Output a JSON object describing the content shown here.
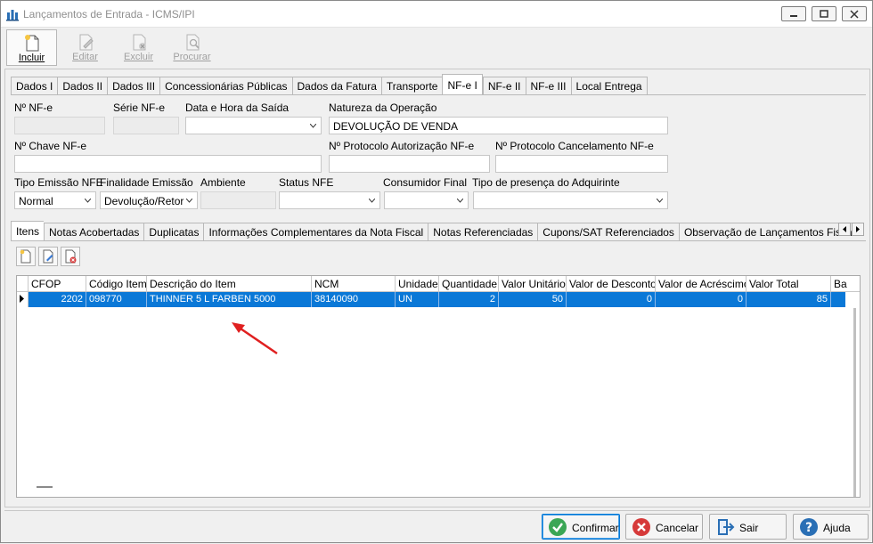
{
  "window": {
    "title": "Lançamentos de Entrada - ICMS/IPI"
  },
  "toolbar": {
    "incluir": "Incluir",
    "editar": "Editar",
    "excluir": "Excluir",
    "procurar": "Procurar"
  },
  "tabs": [
    "Dados I",
    "Dados II",
    "Dados III",
    "Concessionárias Públicas",
    "Dados da Fatura",
    "Transporte",
    "NF-e I",
    "NF-e II",
    "NF-e III",
    "Local Entrega"
  ],
  "form": {
    "nf_e_label": "Nº NF-e",
    "nf_e_value": "",
    "serie_label": "Série NF-e",
    "serie_value": "",
    "data_saida_label": "Data e Hora da Saída",
    "data_saida_value": "",
    "natureza_label": "Natureza da Operação",
    "natureza_value": "DEVOLUÇÃO DE VENDA",
    "chave_label": "Nº Chave NF-e",
    "chave_value": "",
    "protocolo_aut_label": "Nº Protocolo Autorização NF-e",
    "protocolo_aut_value": "",
    "protocolo_canc_label": "Nº Protocolo Cancelamento NF-e",
    "protocolo_canc_value": "",
    "tipo_emissao_label": "Tipo Emissão NFE",
    "tipo_emissao_value": "Normal",
    "finalidade_label": "Finalidade Emissão",
    "finalidade_value": "Devolução/Retor",
    "ambiente_label": "Ambiente",
    "ambiente_value": "",
    "status_label": "Status NFE",
    "status_value": "",
    "consumidor_label": "Consumidor Final",
    "consumidor_value": "",
    "presenca_label": "Tipo de presença do Adquirinte",
    "presenca_value": ""
  },
  "item_tabs": [
    "Itens",
    "Notas Acobertadas",
    "Duplicatas",
    "Informações Complementares da Nota Fiscal",
    "Notas Referenciadas",
    "Cupons/SAT Referenciados",
    "Observação de Lançamentos Fiscais (C"
  ],
  "grid": {
    "columns": [
      "CFOP",
      "Código Item",
      "Descrição do Item",
      "NCM",
      "Unidade",
      "Quantidade",
      "Valor Unitário",
      "Valor de Desconto",
      "Valor de Acréscimo",
      "Valor Total",
      "Ba"
    ],
    "rows": [
      {
        "cfop": "2202",
        "codigo": "098770",
        "descricao": "THINNER 5 L FARBEN 5000",
        "ncm": "38140090",
        "unidade": "UN",
        "quantidade": "2",
        "valor_unitario": "50",
        "desconto": "0",
        "acrescimo": "0",
        "total": "85",
        "ba": ""
      }
    ]
  },
  "footer": {
    "confirmar": "Confirmar",
    "cancelar": "Cancelar",
    "sair": "Sair",
    "ajuda": "Ajuda"
  },
  "colors": {
    "selection": "#0a78d7",
    "accent_border": "#0078d7",
    "annotation_arrow": "#e02020"
  }
}
